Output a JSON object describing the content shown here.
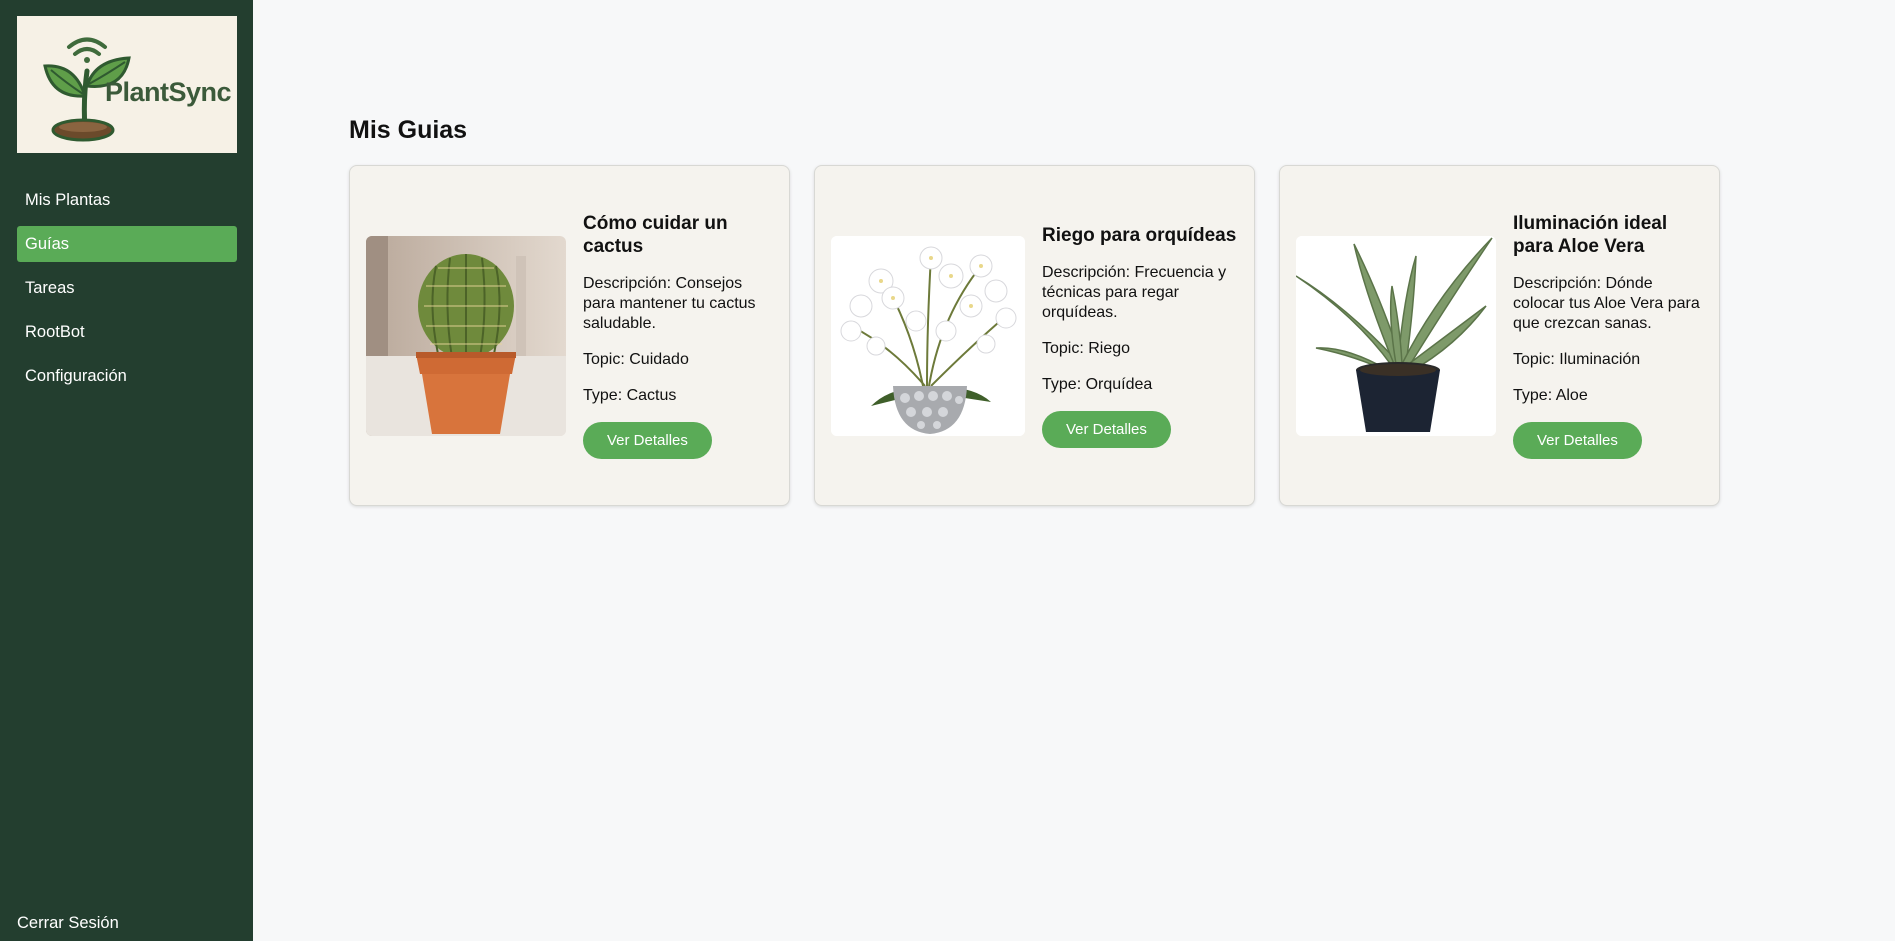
{
  "brand": {
    "name": "PlantSync",
    "accent": "#5aab57",
    "sidebar_bg": "#233e2f"
  },
  "sidebar": {
    "items": [
      {
        "label": "Mis Plantas",
        "active": false
      },
      {
        "label": "Guías",
        "active": true
      },
      {
        "label": "Tareas",
        "active": false
      },
      {
        "label": "RootBot",
        "active": false
      },
      {
        "label": "Configuración",
        "active": false
      }
    ],
    "logout_label": "Cerrar Sesión"
  },
  "main": {
    "title": "Mis Guias",
    "guides": [
      {
        "title": "Cómo cuidar un cactus",
        "description": "Descripción: Consejos para mantener tu cactus saludable.",
        "topic": "Topic: Cuidado",
        "type": "Type: Cactus",
        "button": "Ver Detalles",
        "image": "cactus-photo"
      },
      {
        "title": "Riego para orquídeas",
        "description": "Descripción: Frecuencia y técnicas para regar orquídeas.",
        "topic": "Topic: Riego",
        "type": "Type: Orquídea",
        "button": "Ver Detalles",
        "image": "orchid-photo"
      },
      {
        "title": "Iluminación ideal para Aloe Vera",
        "description": "Descripción: Dónde colocar tus Aloe Vera para que crezcan sanas.",
        "topic": "Topic: Iluminación",
        "type": "Type: Aloe",
        "button": "Ver Detalles",
        "image": "aloe-photo"
      }
    ]
  }
}
